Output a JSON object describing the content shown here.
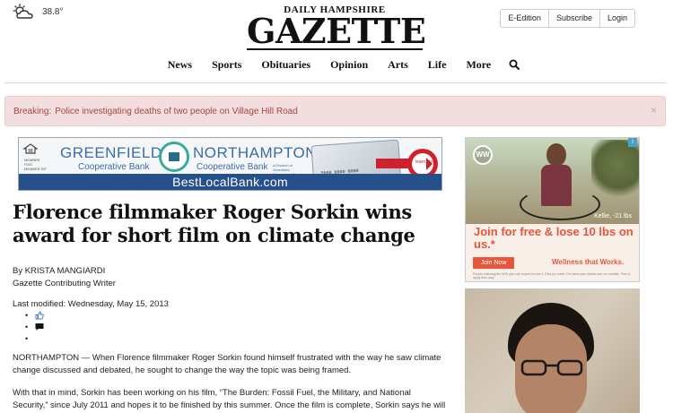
{
  "weather": {
    "icon": "partly-cloudy-icon",
    "temperature": "38.8°"
  },
  "masthead": {
    "line1": "DAILY HAMPSHIRE",
    "line2": "GAZETTE"
  },
  "account": {
    "eedition": "E-Edition",
    "subscribe": "Subscribe",
    "login": "Login"
  },
  "nav": {
    "items": [
      "News",
      "Sports",
      "Obituaries",
      "Opinion",
      "Arts",
      "Life",
      "More"
    ],
    "search_icon": "search-icon"
  },
  "breaking": {
    "label": "Breaking:",
    "text": "Police investigating deaths of two people on Village Hill Road",
    "close": "×"
  },
  "banner_ad": {
    "greenfield": "GREENFIELD",
    "greenfield_sub": "Cooperative Bank",
    "northampton": "NORTHAMPTON",
    "northampton_sub": "Cooperative Bank",
    "northampton_small": "A Division of Greenfield Cooperative Bank",
    "fdic": "MEMBER FDIC MEMBER SIF",
    "card_number": "5000 0000 0000",
    "learn_more": "learn more",
    "url": "BestLocalBank.com"
  },
  "article": {
    "headline": "Florence filmmaker Roger Sorkin wins award for short film on climate change",
    "author": "By KRISTA MANGIARDI",
    "author_role": "Gazette Contributing Writer",
    "last_modified": "Last modified: Wednesday, May 15, 2013",
    "share_icons": [
      "thumbs-up-icon",
      "comment-icon",
      ""
    ],
    "paragraphs": [
      "NORTHAMPTON — When Florence filmmaker Roger Sorkin found himself frustrated with the way he saw climate change discussed and debated, he sought to change the way the topic was being framed.",
      "With that in mind, Sorkin has been working on his film, “The Burden: Fossil Fuel, the Military, and National Security,” since July 2011 and hopes it to be finished by this summer. Once the film is complete, Sorkin says he will"
    ]
  },
  "side_ad": {
    "brand": "WW",
    "badge": "i",
    "caption": "Kellie, -21 lbs",
    "promo": "Join for free & lose 10 lbs on us.*",
    "cta": "Join Now",
    "tagline": "Wellness that Works.",
    "fine_print": "People following the WW plan can expect to lose 1-2 lbs per week. For latest plan details see our website. Plan & apply fees vary."
  },
  "colors": {
    "breaking_bg": "#f2dede",
    "breaking_text": "#a94442",
    "ad_blue": "#26508a",
    "ad_orange": "#e8563a"
  }
}
